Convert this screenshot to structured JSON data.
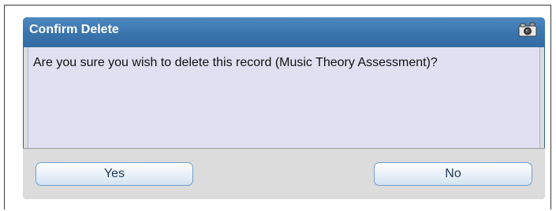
{
  "dialog": {
    "title": "Confirm Delete",
    "message": "Are you sure you wish to delete this record (Music Theory Assessment)?",
    "icon": "camera-icon",
    "buttons": {
      "yes": "Yes",
      "no": "No"
    }
  },
  "colors": {
    "titlebar": "#3a74ac",
    "body": "#e0e0f2",
    "footer": "#dcdcdc",
    "button_border": "#6f9fcf"
  }
}
